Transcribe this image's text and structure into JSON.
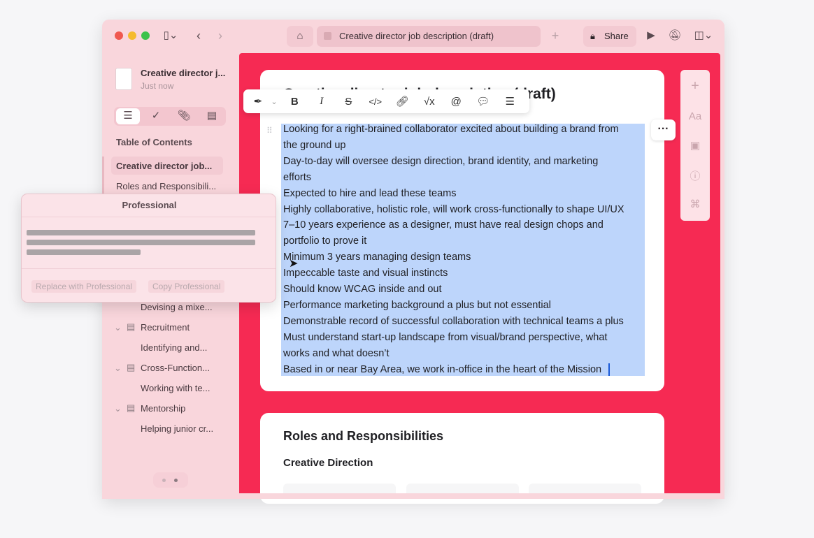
{
  "window": {
    "tab_title": "Creative director job description (draft)",
    "share_label": "Share"
  },
  "sidebar": {
    "doc_title": "Creative director j...",
    "doc_time": "Just now",
    "toc_heading": "Table of Contents",
    "items": [
      {
        "label": "Creative director job...",
        "level": 0,
        "active": true
      },
      {
        "label": "Roles and Responsibili...",
        "level": 0
      },
      {
        "label": "Devising a mixe...",
        "level": 2
      },
      {
        "label": "Recruitment",
        "level": 1
      },
      {
        "label": "Identifying and...",
        "level": 2
      },
      {
        "label": "Cross-Function...",
        "level": 1
      },
      {
        "label": "Working with te...",
        "level": 2
      },
      {
        "label": "Mentorship",
        "level": 1
      },
      {
        "label": "Helping junior cr...",
        "level": 2
      }
    ]
  },
  "popover": {
    "title": "Professional",
    "replace_label": "Replace with Professional",
    "copy_label": "Copy Professional"
  },
  "document": {
    "title_partial": "Creative director job description (draft)",
    "lines": [
      "Looking for a right-brained collaborator excited about building a brand from",
      "the ground up",
      "Day-to-day will oversee design direction, brand identity, and marketing",
      "efforts",
      "Expected to hire and lead these teams",
      "Highly collaborative, holistic role, will work cross-functionally to shape UI/UX",
      "7–10 years experience as a designer, must have real design chops and",
      "portfolio to prove it",
      "Minimum 3 years managing design teams",
      "Impeccable taste and visual instincts",
      "Should know WCAG inside and out",
      "Performance marketing background a plus but not essential",
      "Demonstrable record of successful collaboration with technical teams a plus",
      "Must understand start-up landscape from visual/brand perspective, what",
      "works and what doesn’t",
      "Based in or near Bay Area, we work in-office in the heart of the Mission"
    ],
    "section_heading": "Roles and Responsibilities",
    "subheading": "Creative Direction"
  },
  "colors": {
    "accent": "#f62a53",
    "selection": "#bdd5fb",
    "window_bg": "#f9d6dc"
  }
}
